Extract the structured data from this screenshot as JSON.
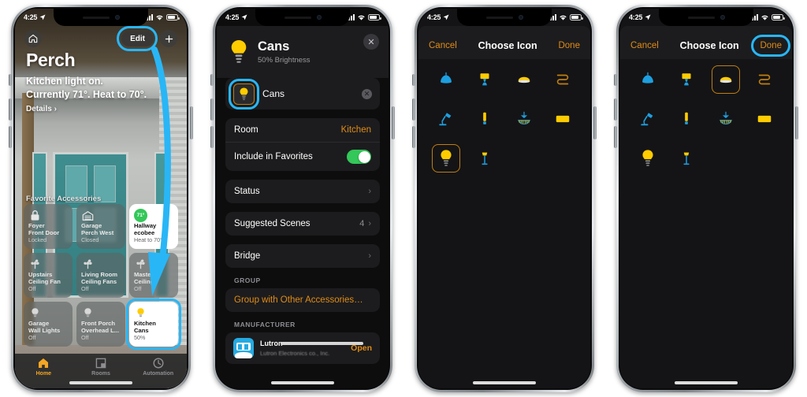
{
  "status_bar": {
    "time": "4:25",
    "location_icon": "location-arrow-icon",
    "signal": "cellular-bars-icon",
    "wifi": "wifi-icon",
    "battery": "battery-icon"
  },
  "phone1": {
    "name": "home-screen",
    "topbar": {
      "home_icon": "house-icon",
      "edit_label": "Edit",
      "add_label": "+"
    },
    "header": {
      "title": "Perch",
      "status_line1": "Kitchen light on.",
      "status_line2": "Currently 71°. Heat to 70°.",
      "details_label": "Details ›"
    },
    "favorites_label": "Favorite Accessories",
    "tiles": [
      {
        "name": "Foyer",
        "sub_name": "Front Door",
        "state": "Locked",
        "icon": "lock-icon",
        "on": false
      },
      {
        "name": "Garage",
        "sub_name": "Perch West",
        "state": "Closed",
        "icon": "garage-door-icon",
        "on": false
      },
      {
        "name": "Hallway",
        "sub_name": "ecobee",
        "state": "Heat to 70°",
        "icon": "thermostat-icon",
        "badge": "71°",
        "on": true
      },
      {
        "name": "Upstairs",
        "sub_name": "Ceiling Fan",
        "state": "Off",
        "icon": "fan-icon",
        "on": false
      },
      {
        "name": "Living Room",
        "sub_name": "Ceiling Fans",
        "state": "Off",
        "icon": "fan-icon",
        "on": false
      },
      {
        "name": "Master",
        "sub_name": "Ceiling",
        "state": "Off",
        "icon": "fan-icon",
        "on": false
      },
      {
        "name": "Garage",
        "sub_name": "Wall Lights",
        "state": "Off",
        "icon": "bulb-icon",
        "on": false
      },
      {
        "name": "Front Porch",
        "sub_name": "Overhead L...",
        "state": "Off",
        "icon": "bulb-icon",
        "on": false
      },
      {
        "name": "Kitchen",
        "sub_name": "Cans",
        "state": "50%",
        "icon": "bulb-icon",
        "on": true
      }
    ],
    "tabs": [
      {
        "label": "Home",
        "icon": "house-icon",
        "active": true
      },
      {
        "label": "Rooms",
        "icon": "rooms-icon",
        "active": false
      },
      {
        "label": "Automation",
        "icon": "clock-icon",
        "active": false
      }
    ]
  },
  "phone2": {
    "name": "accessory-detail-screen",
    "header": {
      "title": "Cans",
      "subtitle": "50% Brightness",
      "icon": "bulb-icon",
      "close": "✕"
    },
    "name_field": {
      "value": "Cans",
      "icon": "bulb-icon",
      "clear": "✕"
    },
    "rows": [
      {
        "label": "Room",
        "value": "Kitchen",
        "type": "accent"
      },
      {
        "label": "Include in Favorites",
        "value": "on",
        "type": "toggle"
      }
    ],
    "nav_rows": [
      {
        "label": "Status",
        "value": "",
        "chevron": "›"
      },
      {
        "label": "Suggested Scenes",
        "value": "4",
        "chevron": "›"
      },
      {
        "label": "Bridge",
        "value": "",
        "chevron": "›"
      }
    ],
    "group_section": {
      "label": "GROUP",
      "link": "Group with Other Accessories…"
    },
    "manufacturer_section": {
      "label": "MANUFACTURER",
      "name": "Lutron",
      "sub": "Lutron Electronics co., Inc.",
      "action": "Open"
    }
  },
  "phone3": {
    "name": "choose-icon-screen",
    "nav": {
      "cancel": "Cancel",
      "title": "Choose Icon",
      "done": "Done"
    },
    "selected_index": 8,
    "icons": [
      "pendant-lamp-icon",
      "table-lamp-icon",
      "ceiling-dome-light-icon",
      "light-strip-icon",
      "desk-lamp-icon",
      "tall-lamp-icon",
      "chandelier-icon",
      "panel-light-icon",
      "bulb-icon",
      "floor-lamp-icon"
    ]
  },
  "phone4": {
    "name": "choose-icon-screen-selected",
    "nav": {
      "cancel": "Cancel",
      "title": "Choose Icon",
      "done": "Done"
    },
    "selected_index": 2,
    "icons": [
      "pendant-lamp-icon",
      "table-lamp-icon",
      "ceiling-dome-light-icon",
      "light-strip-icon",
      "desk-lamp-icon",
      "tall-lamp-icon",
      "chandelier-icon",
      "panel-light-icon",
      "bulb-icon",
      "floor-lamp-icon"
    ]
  },
  "annotations": {
    "highlight_color": "#29b6f6",
    "arrow": "curved-arrow-from-edit-to-kitchen-cans"
  },
  "colors": {
    "accent_orange": "#e08c16",
    "toggle_green": "#34c759",
    "bulb_yellow": "#ffcc00",
    "icon_blue": "#1e9fe0",
    "highlight_cyan": "#29b6f6"
  }
}
